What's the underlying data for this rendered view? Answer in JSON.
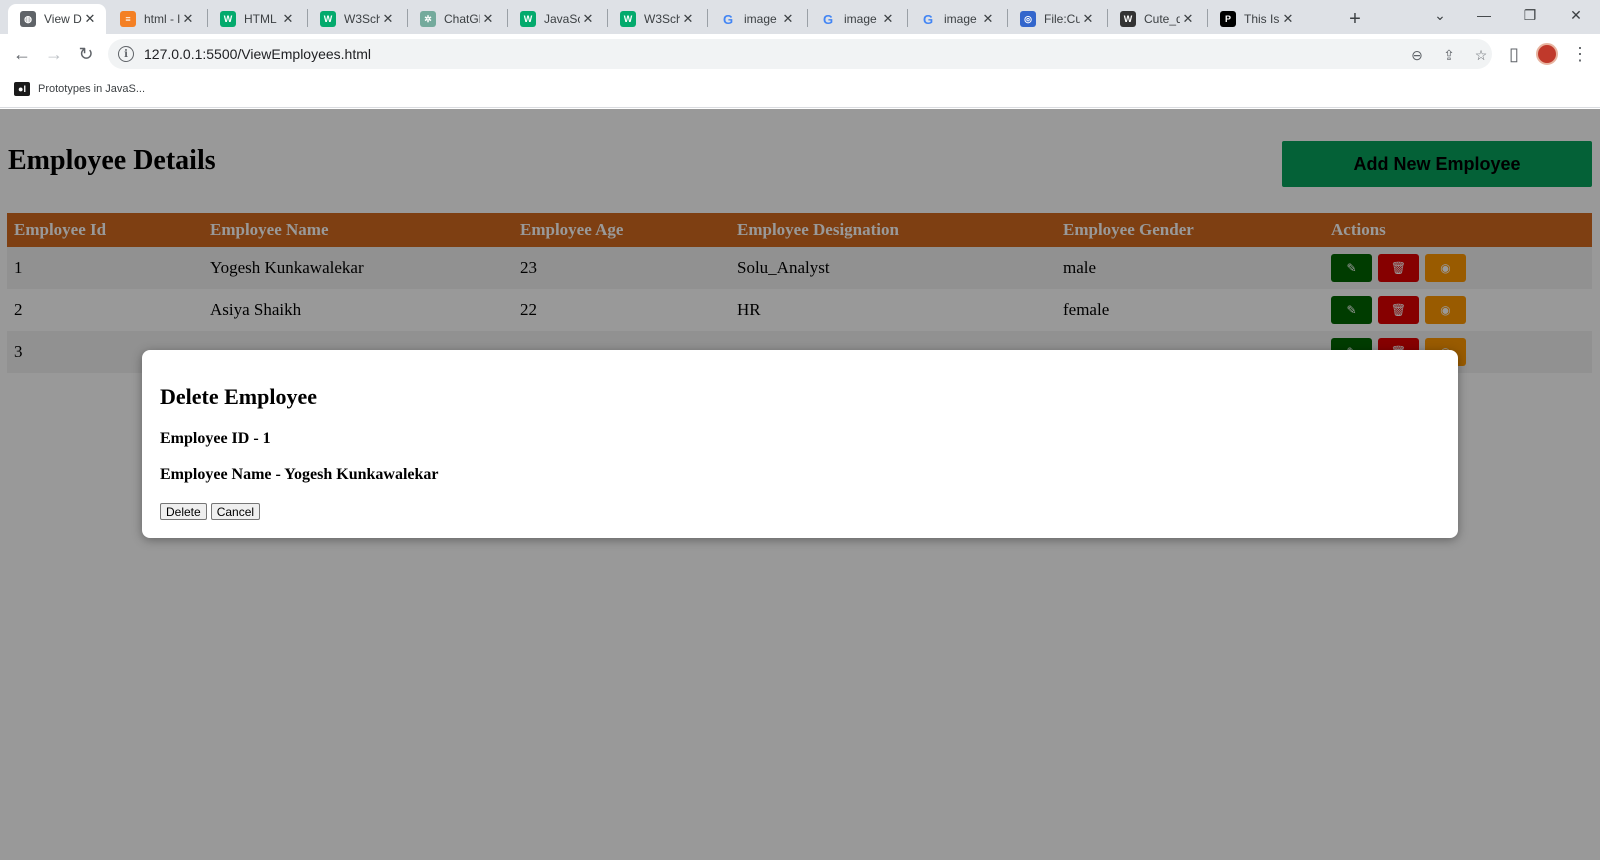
{
  "browser": {
    "tabs": [
      {
        "title": "View D",
        "favicon": "globe-icon",
        "color": "#5f6368",
        "active": true
      },
      {
        "title": "html - l",
        "favicon": "stackoverflow-icon",
        "color": "#f48024"
      },
      {
        "title": "HTML i",
        "favicon": "w3schools-icon",
        "color": "#04aa6d"
      },
      {
        "title": "W3Sch",
        "favicon": "w3schools-icon",
        "color": "#04aa6d"
      },
      {
        "title": "ChatGP",
        "favicon": "chatgpt-icon",
        "color": "#74aa9c"
      },
      {
        "title": "JavaScr",
        "favicon": "w3schools-icon",
        "color": "#04aa6d"
      },
      {
        "title": "W3Sch",
        "favicon": "w3schools-icon",
        "color": "#04aa6d"
      },
      {
        "title": "image",
        "favicon": "google-icon",
        "color": "#4285f4"
      },
      {
        "title": "image",
        "favicon": "google-icon",
        "color": "#4285f4"
      },
      {
        "title": "image",
        "favicon": "google-icon",
        "color": "#4285f4"
      },
      {
        "title": "File:Cut",
        "favicon": "wikimedia-icon",
        "color": "#3366cc"
      },
      {
        "title": "Cute_d",
        "favicon": "wikipedia-icon",
        "color": "#333333"
      },
      {
        "title": "This Is",
        "favicon": "prototype-icon",
        "color": "#000000"
      }
    ],
    "url": "127.0.0.1:5500/ViewEmployees.html",
    "bookmark": "Prototypes in JavaS..."
  },
  "page": {
    "title": "Employee Details",
    "add_button": "Add New Employee",
    "colors": {
      "header": "#d2691e",
      "add": "#07a25d",
      "edit": "#006400",
      "delete": "#e00000",
      "view": "#ff9800"
    },
    "columns": [
      "Employee Id",
      "Employee Name",
      "Employee Age",
      "Employee Designation",
      "Employee Gender",
      "Actions"
    ],
    "rows": [
      {
        "id": "1",
        "name": "Yogesh Kunkawalekar",
        "age": "23",
        "designation": "Solu_Analyst",
        "gender": "male"
      },
      {
        "id": "2",
        "name": "Asiya Shaikh",
        "age": "22",
        "designation": "HR",
        "gender": "female"
      },
      {
        "id": "3",
        "name": "",
        "age": "",
        "designation": "",
        "gender": ""
      }
    ]
  },
  "modal": {
    "title": "Delete Employee",
    "id_line": "Employee ID - 1",
    "name_line": "Employee Name - Yogesh Kunkawalekar",
    "delete_label": "Delete",
    "cancel_label": "Cancel"
  }
}
